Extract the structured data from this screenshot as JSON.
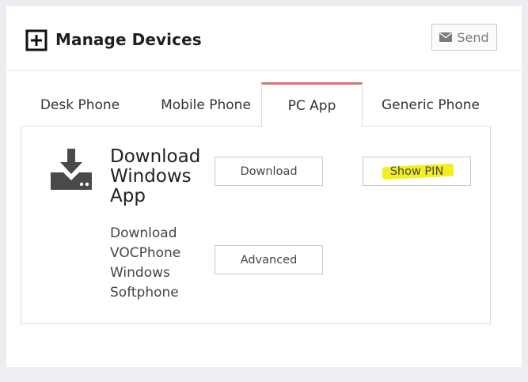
{
  "header": {
    "title": "Manage Devices",
    "add_icon": "plus-square-icon",
    "send_label": "Send",
    "send_icon": "envelope-icon"
  },
  "tabs": [
    {
      "label": "Desk Phone",
      "active": false
    },
    {
      "label": "Mobile Phone",
      "active": false
    },
    {
      "label": "PC App",
      "active": true
    },
    {
      "label": "Generic Phone",
      "active": false
    }
  ],
  "panel": {
    "icon": "download-tray-icon",
    "heading_lines": [
      "Download",
      "Windows",
      "App"
    ],
    "description_lines": [
      "Download",
      "VOCPhone",
      "Windows",
      "Softphone"
    ],
    "download_label": "Download",
    "advanced_label": "Advanced",
    "show_pin_label": "Show PIN"
  },
  "colors": {
    "active_tab_accent": "#d9746f",
    "highlight": "#f4ee1f",
    "icon": "#4a4a4a"
  }
}
